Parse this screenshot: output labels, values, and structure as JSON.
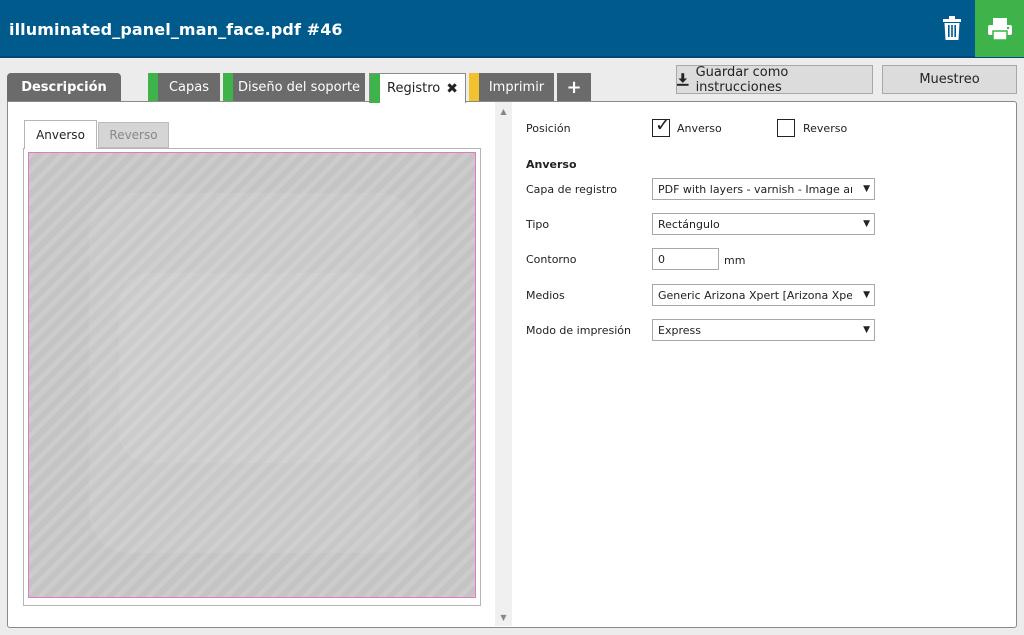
{
  "header": {
    "title": "illuminated_panel_man_face.pdf #46",
    "bg_color": "#005a8c",
    "print_color": "#3db34a"
  },
  "tabs": [
    {
      "label": "Descripción",
      "icon": ""
    },
    {
      "label": "Capas",
      "stripe_color": "#3db34a"
    },
    {
      "label": "Diseño del soporte",
      "stripe_color": "#3db34a"
    },
    {
      "label": "Registro",
      "stripe_color": "#3db34a",
      "active": true,
      "close_icon": "✖"
    },
    {
      "label": "Imprimir",
      "stripe_color": "#f2c12e"
    },
    {
      "label": "+",
      "icon": "plus-icon"
    }
  ],
  "toolbar": {
    "save_label": "Guardar como instrucciones",
    "sample_label": "Muestreo"
  },
  "preview": {
    "tabs": [
      "Anverso",
      "Reverso"
    ],
    "active_tab": "Anverso",
    "border_color": "#e07ac8"
  },
  "form": {
    "position_label": "Posición",
    "front_label": "Anverso",
    "front_checked": true,
    "back_label": "Reverso",
    "back_checked": false,
    "section_title": "Anverso",
    "layer_label": "Capa de registro",
    "layer_value": "PDF with layers - varnish - Image area varnish",
    "type_label": "Tipo",
    "type_value": "Rectángulo",
    "contour_label": "Contorno",
    "contour_value": "0",
    "contour_unit": "mm",
    "media_label": "Medios",
    "media_value": "Generic Arizona Xpert [Arizona Xpert]",
    "mode_label": "Modo de impresión",
    "mode_value": "Express"
  }
}
